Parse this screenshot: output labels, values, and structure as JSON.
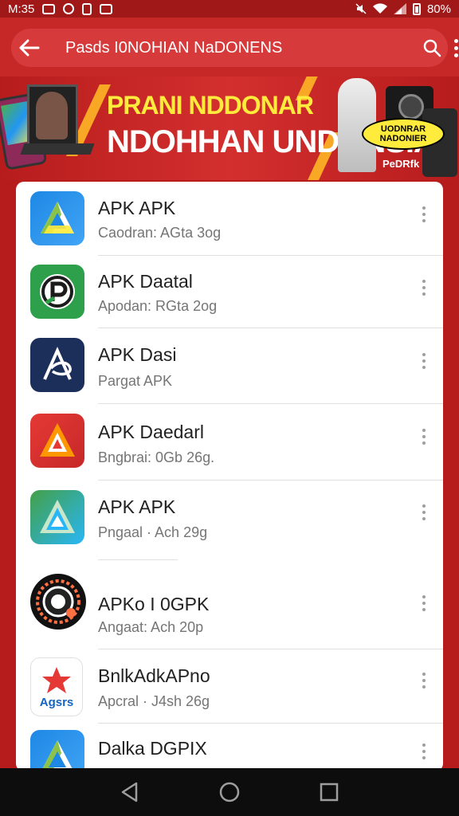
{
  "status": {
    "time": "M:35",
    "battery": "80%",
    "icons": [
      "photo-icon",
      "record-icon",
      "clipboard-icon",
      "message-icon",
      "mute-icon",
      "wifi-icon",
      "signal-icon",
      "battery-icon"
    ]
  },
  "header": {
    "search_text": "Pasds I0NOHIAN NaDONENS",
    "back_icon": "arrow-left-icon",
    "search_icon": "search-icon",
    "menu_icon": "more-vert-icon"
  },
  "banner": {
    "title_line1": "PRANI NDDONAR",
    "title_line2": "NDOHHAN UNDONSIA!",
    "badge_line1": "UODNRAR",
    "badge_line2": "NADONIER",
    "badge_small": "PeDRfk"
  },
  "colors": {
    "appbar": "#c62828",
    "statusbar": "#a01818",
    "banner_yellow": "#ffeb3b"
  },
  "apps": [
    {
      "name": "APK APK",
      "subtitle": "Caodran: AGta 3og",
      "icon": "triangle-blue-yellow-icon"
    },
    {
      "name": "APK Daatal",
      "subtitle": "Apodan: RGta 2og",
      "icon": "green-p-circle-icon"
    },
    {
      "name": "APK Dasi",
      "subtitle": "Pargat APK",
      "icon": "navy-a-icon"
    },
    {
      "name": "APK Daedarl",
      "subtitle": "Bngbrai: 0Gb 26g.",
      "icon": "red-triangle-icon"
    },
    {
      "name": "APK APK",
      "subtitle": "Pngaal · Ach 29g",
      "icon": "triangle-green-blue-icon"
    },
    {
      "name": "APKo I 0GPK",
      "subtitle": "Angaat: Ach 20p",
      "icon": "black-ring-icon"
    },
    {
      "name": "BnlkAdkAPno",
      "subtitle": "Apcral · J4sh 26g",
      "icon": "red-star-icon",
      "icon_text": "Agsrs"
    },
    {
      "name": "Dalka DGPIX",
      "subtitle": "",
      "icon": "triangle-blue-yellow-icon"
    }
  ],
  "navbar": [
    "back-nav-icon",
    "home-nav-icon",
    "recents-nav-icon"
  ]
}
